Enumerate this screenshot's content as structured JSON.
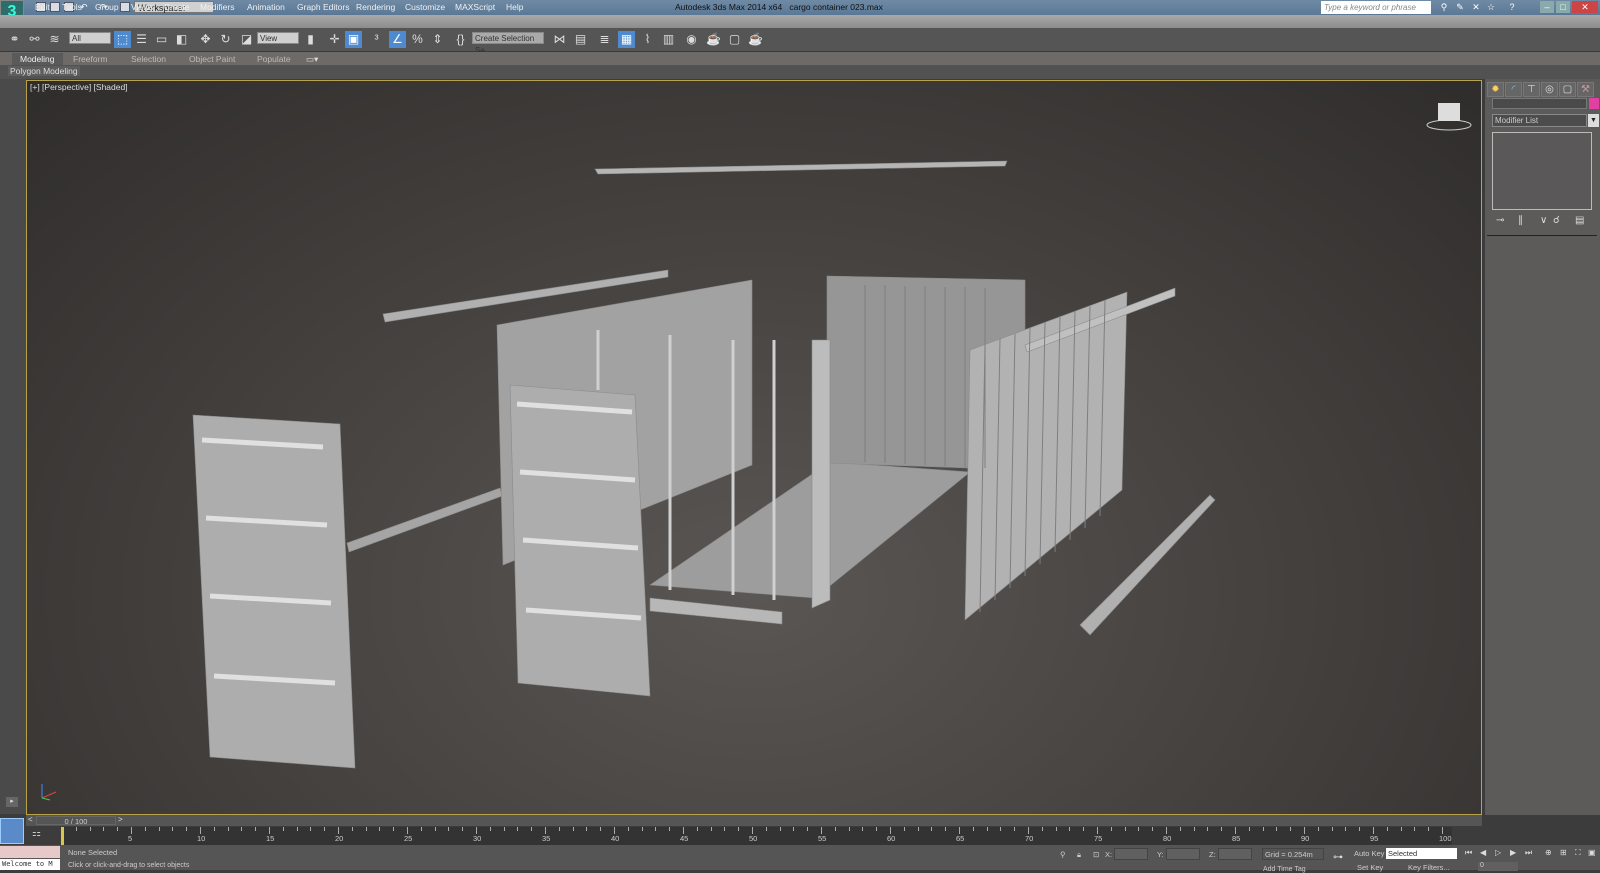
{
  "title_bar": {
    "app_title": "Autodesk 3ds Max 2014 x64",
    "file_name": "cargo container 023.max",
    "workspace": "Workspace: Default",
    "search_placeholder": "Type a keyword or phrase"
  },
  "menu": [
    "Edit",
    "Tools",
    "Group",
    "Views",
    "Create",
    "Modifiers",
    "Animation",
    "Graph Editors",
    "Rendering",
    "Customize",
    "MAXScript",
    "Help"
  ],
  "toolbar": {
    "selection_filter": "All",
    "reference_coord": "View",
    "named_selection": "Create Selection Se"
  },
  "ribbon": {
    "tabs": [
      "Modeling",
      "Freeform",
      "Selection",
      "Object Paint",
      "Populate"
    ],
    "active_tab": "Modeling",
    "panel": "Polygon Modeling"
  },
  "viewport": {
    "label": "[+] [Perspective] [Shaded]"
  },
  "command_panel": {
    "modifier_list": "Modifier List",
    "object_color": "#e040a0"
  },
  "timeline": {
    "frame": "0 / 100",
    "ticks": [
      "5",
      "10",
      "15",
      "20",
      "25",
      "30",
      "35",
      "40",
      "45",
      "50",
      "55",
      "60",
      "65",
      "70",
      "75",
      "80",
      "85",
      "90",
      "95",
      "100"
    ]
  },
  "status": {
    "selection": "None Selected",
    "prompt": "Click or click-and-drag to select objects",
    "maxscript": "Welcome to M",
    "x_label": "X:",
    "y_label": "Y:",
    "z_label": "Z:",
    "grid": "Grid = 0.254m",
    "add_time_tag": "Add Time Tag",
    "auto_key": "Auto Key",
    "set_key": "Set Key",
    "key_mode": "Selected",
    "key_filters": "Key Filters...",
    "current_frame": "0"
  },
  "colors": {
    "viewport_border": "#b8a24a",
    "active_tool": "#4e8ad0"
  }
}
